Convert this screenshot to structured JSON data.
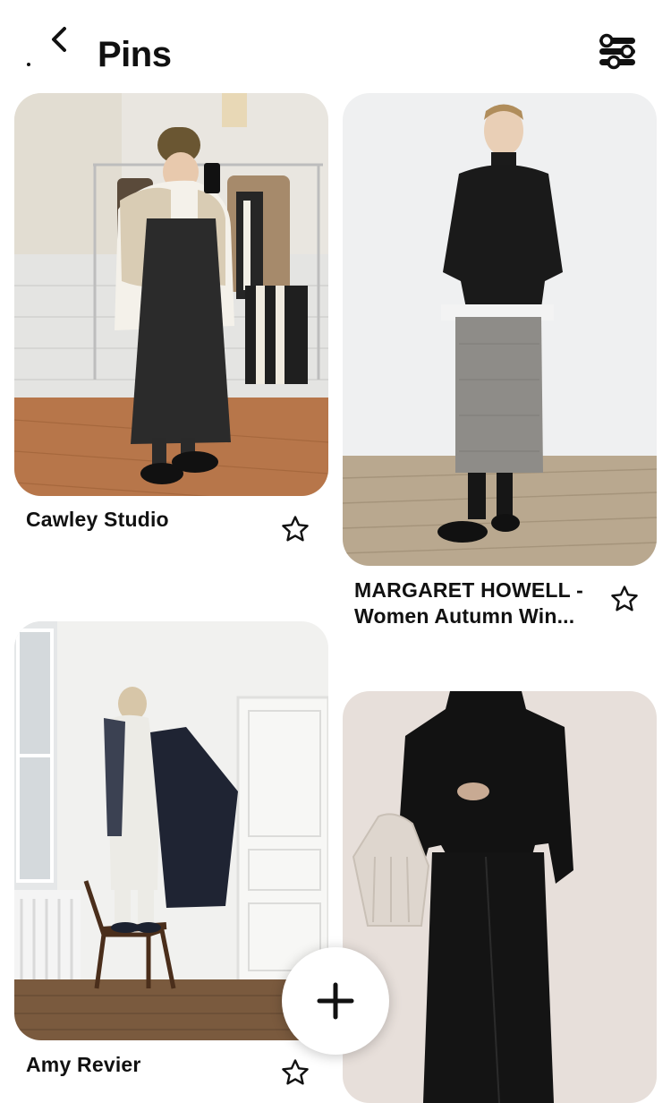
{
  "header": {
    "title": "Pins",
    "back_icon": "chevron-left-icon",
    "filter_icon": "sliders-icon"
  },
  "pins": [
    {
      "title": "Cawley Studio",
      "action_icon": "star-outline-icon"
    },
    {
      "title_line1": "MARGARET HOWELL -",
      "title_line2": "Women Autumn Win...",
      "action_icon": "star-outline-icon"
    },
    {
      "title": "Amy Revier",
      "action_icon": "star-outline-icon"
    },
    {
      "title": "",
      "action_icon": ""
    }
  ],
  "fab": {
    "icon": "plus-icon"
  },
  "colors": {
    "text": "#111111",
    "background": "#ffffff"
  }
}
